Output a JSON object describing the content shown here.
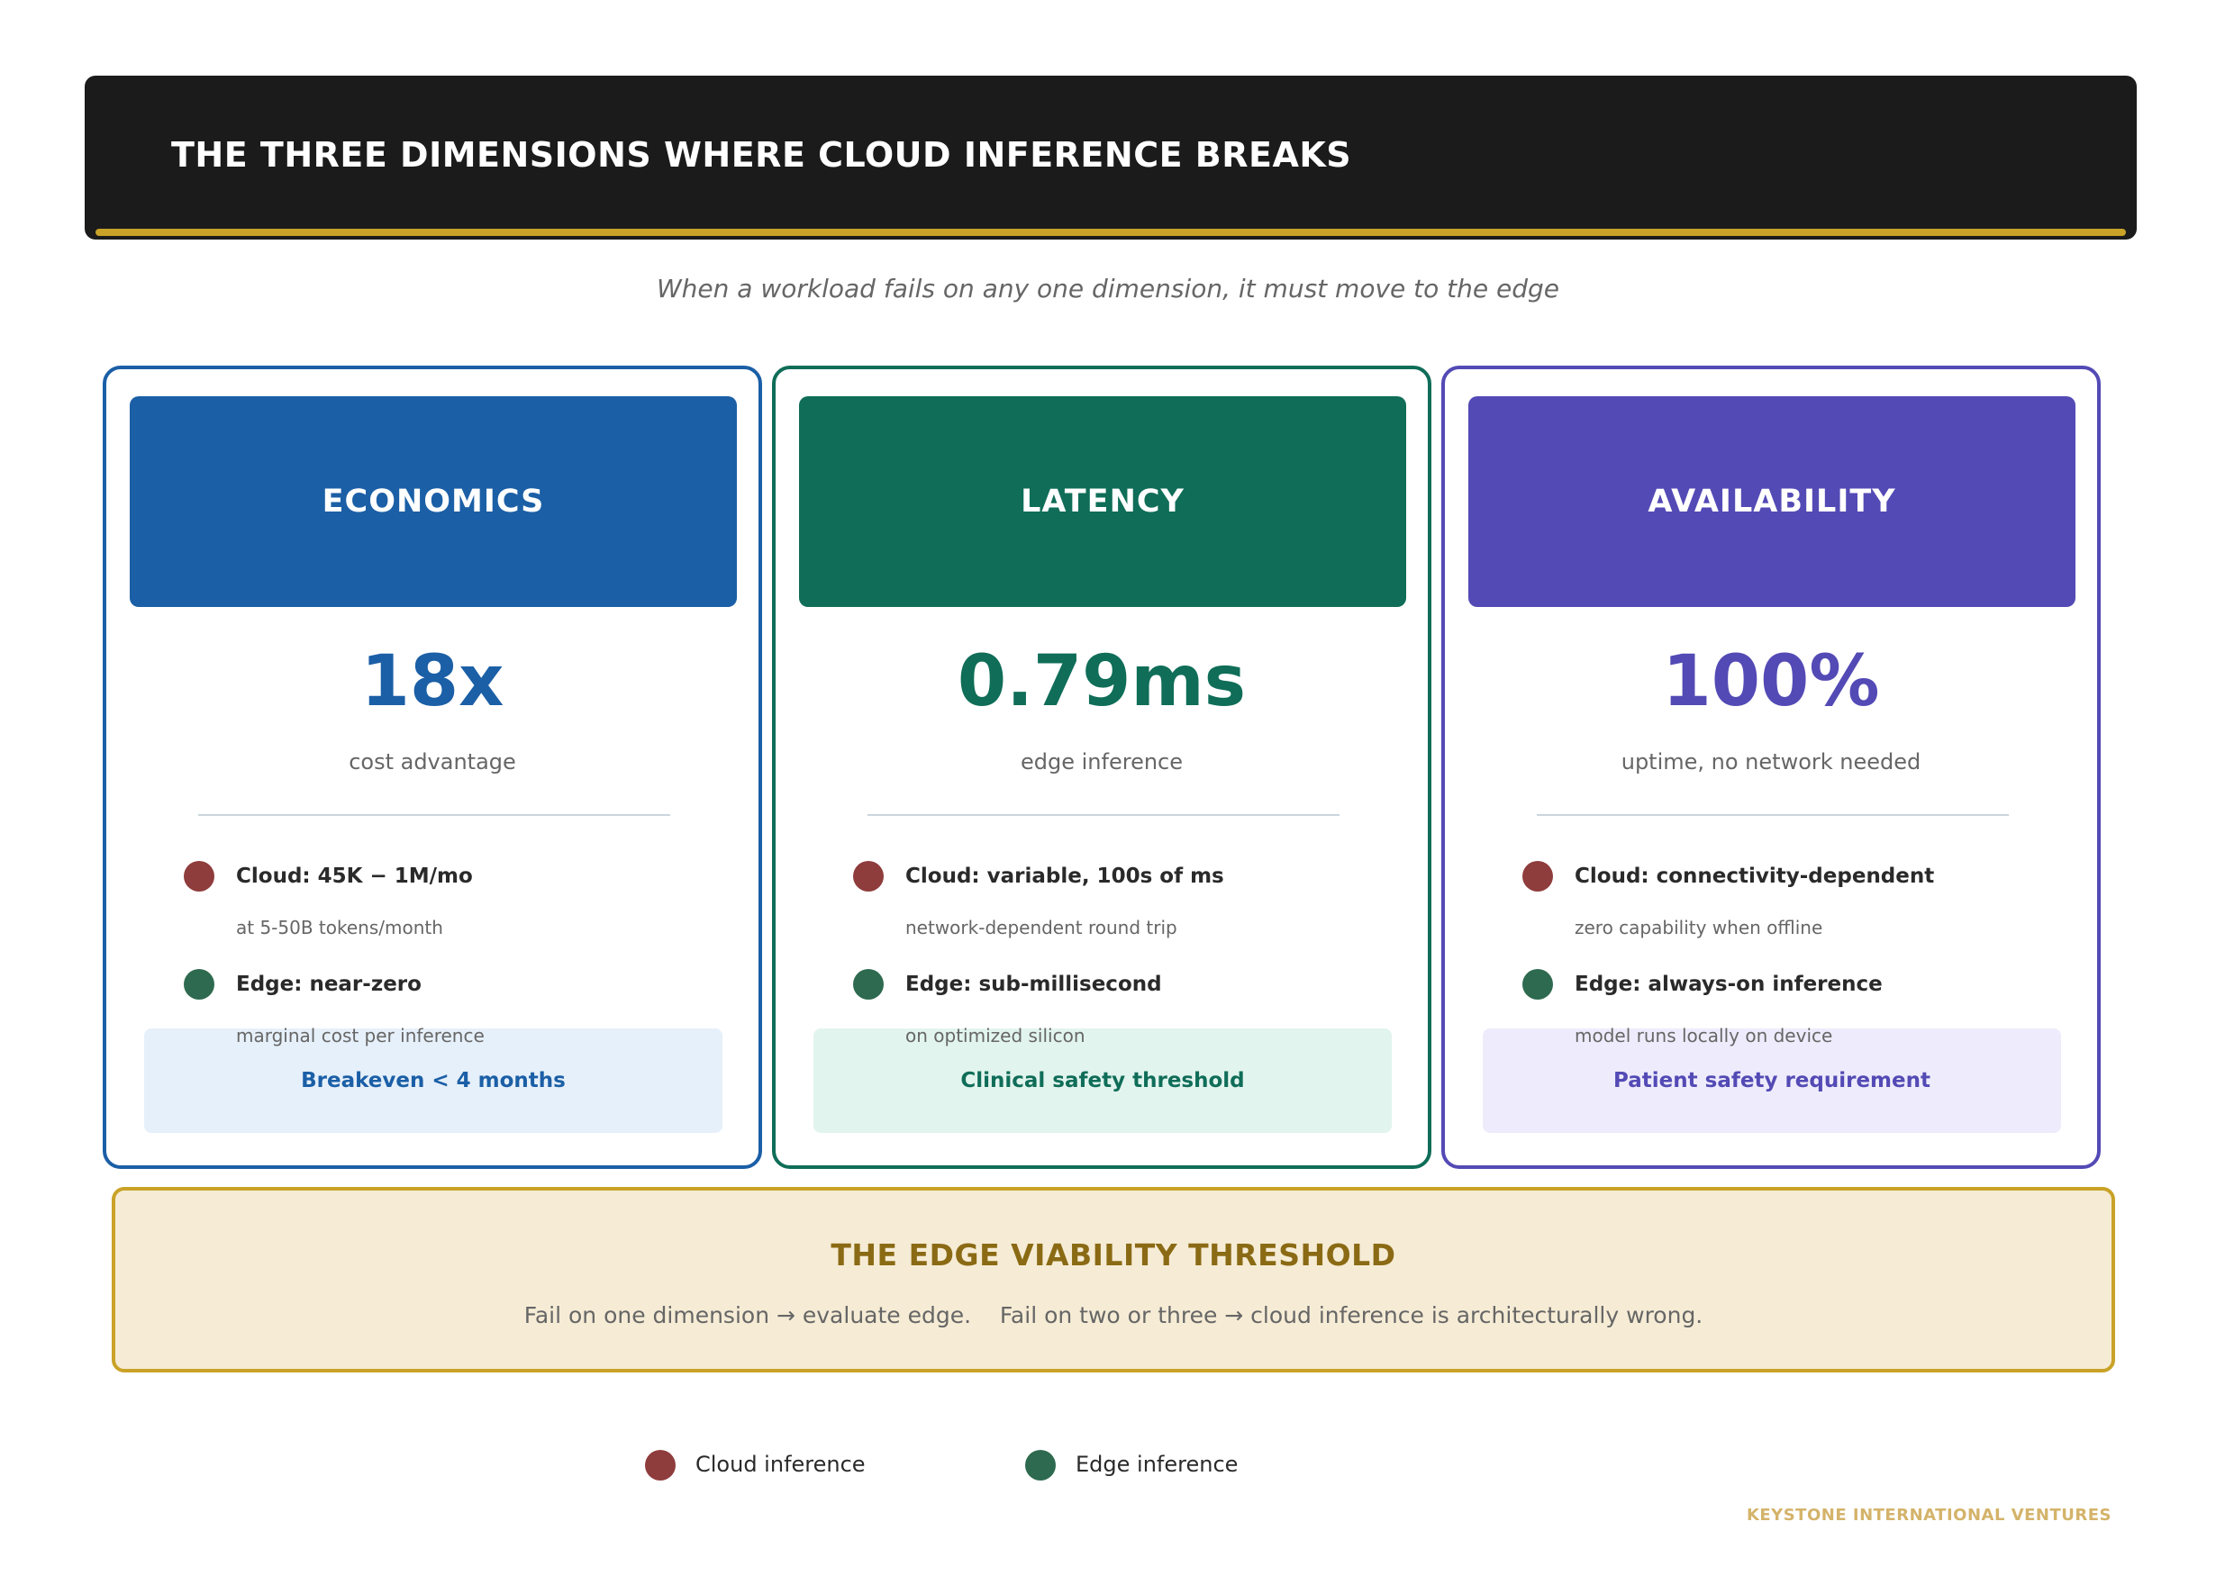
{
  "header": {
    "title": "THE THREE DIMENSIONS WHERE CLOUD INFERENCE BREAKS"
  },
  "subtitle": "When a workload fails on any one dimension, it must move to the edge",
  "colors": {
    "header_bg": "#1b1b1b",
    "gold_accent": "#c9a227",
    "economics": "#1b5fa6",
    "latency": "#0f6d58",
    "availability": "#534ab5",
    "cloud_marker": "#8f3c3c",
    "edge_marker": "#2e6a4f",
    "threshold_bg": "#f6ecd5"
  },
  "cards": [
    {
      "title": "ECONOMICS",
      "metric": "18x",
      "metric_label": "cost advantage",
      "cloud_main": "Cloud: 45K − 1M/mo",
      "cloud_sub": "at 5-50B tokens/month",
      "edge_main": "Edge: near-zero",
      "edge_sub": "marginal cost per inference",
      "callout": "Breakeven < 4 months"
    },
    {
      "title": "LATENCY",
      "metric": "0.79ms",
      "metric_label": "edge inference",
      "cloud_main": "Cloud: variable, 100s of ms",
      "cloud_sub": "network-dependent round trip",
      "edge_main": "Edge: sub-millisecond",
      "edge_sub": "on optimized silicon",
      "callout": "Clinical safety threshold"
    },
    {
      "title": "AVAILABILITY",
      "metric": "100%",
      "metric_label": "uptime, no network needed",
      "cloud_main": "Cloud: connectivity-dependent",
      "cloud_sub": "zero capability when offline",
      "edge_main": "Edge: always-on inference",
      "edge_sub": "model runs locally on device",
      "callout": "Patient safety requirement"
    }
  ],
  "threshold": {
    "title": "THE EDGE VIABILITY THRESHOLD",
    "text": "Fail on one dimension → evaluate edge.    Fail on two or three → cloud inference is architecturally wrong."
  },
  "legend": {
    "cloud": "Cloud inference",
    "edge": "Edge inference"
  },
  "footer": "KEYSTONE INTERNATIONAL VENTURES"
}
